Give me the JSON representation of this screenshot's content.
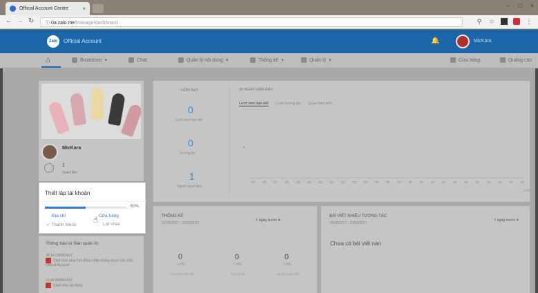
{
  "browser": {
    "tab_title": "Official Account Centre",
    "url_host": "0a.zalo.me",
    "url_path": "/manage/dashboard"
  },
  "app": {
    "logo_text": "Zalo",
    "name": "Official Account",
    "username": "MicKara"
  },
  "menu": {
    "items": [
      {
        "label": "Broadcast"
      },
      {
        "label": "Chat"
      },
      {
        "label": "Quản lý nội dung"
      },
      {
        "label": "Thống kê"
      },
      {
        "label": "Quản lý"
      }
    ],
    "right_items": [
      {
        "label": "Cửa hàng"
      },
      {
        "label": "Quảng cáo"
      }
    ]
  },
  "profile": {
    "page_name": "MicKara",
    "followers": "1",
    "followers_label": "Quan tâm"
  },
  "setup": {
    "title": "Thiết lập tài khoản",
    "progress_percent": 50,
    "progress_label": "50%",
    "link_address": "Địa chỉ",
    "link_store": "Cửa hàng",
    "done_menu": "Thanh Menu",
    "greeting": "Lời chào"
  },
  "notifications": {
    "title": "Thông báo từ Ban quản trị",
    "items": [
      {
        "date": "18:14 23/09/2017",
        "text": "Cảnh báo phục hồi đồng nhập không được vào Zalo Official Account"
      },
      {
        "date": "16:00 06/09/2017",
        "text": "Cảnh báo nội dung"
      }
    ]
  },
  "stats": {
    "today_title": "HÔM NAY",
    "today_values": [
      {
        "value": "0",
        "label": "Lượt xem bài viết"
      },
      {
        "value": "0",
        "label": "Tương tác"
      },
      {
        "value": "1",
        "label": "Người quan tâm"
      }
    ],
    "recent_title": "30 NGÀY GẦN ĐÂY",
    "tabs": [
      "Lượt xem bài viết",
      "Lượt tương tác",
      "Quan tâm mới"
    ],
    "ticks": [
      "20",
      "26",
      "27",
      "28",
      "29",
      "30",
      "31",
      "01",
      "02",
      "03",
      "04",
      "05",
      "06",
      "07",
      "08",
      "09",
      "10",
      "11",
      "12",
      "13",
      "14",
      "15",
      "16",
      "17",
      "18"
    ],
    "axis_unit": "Lượt"
  },
  "summary": {
    "title": "THỐNG KÊ",
    "date_range": "15/08/2017 - 22/08/2017",
    "select": "7 ngày trước",
    "metrics": [
      {
        "value": "0",
        "pct": "+ 0%",
        "label": "Lượt xem bài viết"
      },
      {
        "value": "0",
        "pct": "+ 0%",
        "label": "Tương tác"
      },
      {
        "value": "0",
        "pct": "+ 0%",
        "label": "Người quan tâm"
      }
    ]
  },
  "top_posts": {
    "title": "BÀI VIẾT NHIỀU TƯƠNG TÁC",
    "date_range": "29/08/2017 - 22/08/2017",
    "select": "7 ngày trước",
    "empty": "Chưa có bài viết nào"
  }
}
